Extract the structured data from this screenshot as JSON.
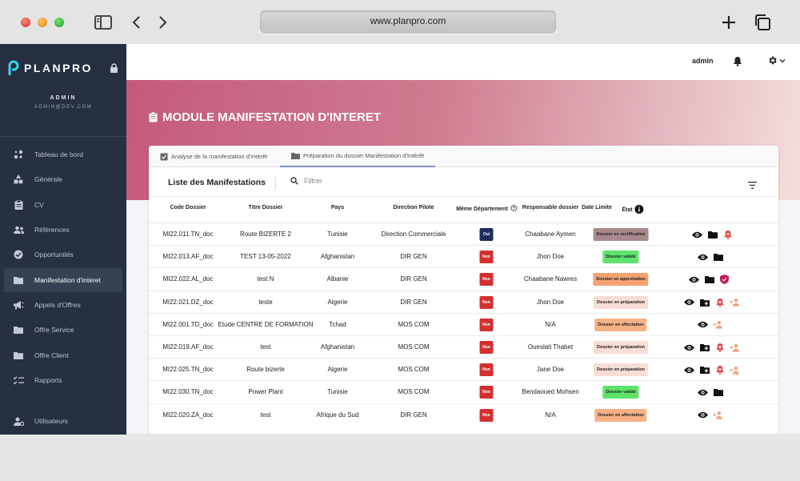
{
  "browser": {
    "url": "www.planpro.com"
  },
  "sidebar": {
    "logo_text": "PLANPRO",
    "admin_title": "ADMIN",
    "admin_email": "ADMIN@DEV.COM",
    "items": [
      {
        "label": "Tableau de bord",
        "icon": "dashboard-icon"
      },
      {
        "label": "Générale",
        "icon": "shapes-icon"
      },
      {
        "label": "CV",
        "icon": "clipboard-icon"
      },
      {
        "label": "Références",
        "icon": "users-icon"
      },
      {
        "label": "Opportunités",
        "icon": "check-circle-icon"
      },
      {
        "label": "Manifestation d'interet",
        "icon": "folder-icon"
      },
      {
        "label": "Appels d'Offres",
        "icon": "megaphone-icon"
      },
      {
        "label": "Offre Service",
        "icon": "folder-icon"
      },
      {
        "label": "Offre Client",
        "icon": "folder-icon"
      },
      {
        "label": "Rapports",
        "icon": "checklist-icon"
      },
      {
        "label": "Utilisateurs",
        "icon": "user-gear-icon"
      }
    ]
  },
  "topbar": {
    "username": "admin"
  },
  "page": {
    "title": "MODULE MANIFESTATION D'INTERET"
  },
  "tabs": [
    {
      "label": "Analyse de la manifestation d'intérêt"
    },
    {
      "label": "Préparation du dossier Manifestation d'Intérêt"
    }
  ],
  "list": {
    "title": "Liste des Manifestations",
    "filter_placeholder": "Filtrer"
  },
  "columns": [
    "Code Dossier",
    "Titre Dossier",
    "Pays",
    "Direction Pilote",
    "Même Département",
    "Responsable dossier",
    "Date Limite",
    "État"
  ],
  "colors": {
    "oui": "#1c2f5e",
    "non": "#d32f2f"
  },
  "rows": [
    {
      "code": "MI22.011.TN_doc",
      "titre": "Route BIZERTE 2",
      "pays": "Tunisie",
      "direction": "Direction Commerciale",
      "dept": "Oui",
      "responsable": "Chaabane Aymen",
      "date": "",
      "etat": "Dossier en rectification",
      "etat_color": "#a9888c",
      "actions": [
        "eye",
        "folder",
        "bell-plus"
      ]
    },
    {
      "code": "MI22.013.AF_doc",
      "titre": "TEST 13-05-2022",
      "pays": "Afghanistan",
      "direction": "DIR GEN",
      "dept": "Non",
      "responsable": "Jhon Doe",
      "date": "",
      "etat": "Dossier validé",
      "etat_color": "#5ee36a",
      "actions": [
        "eye",
        "folder"
      ]
    },
    {
      "code": "MI22.022.AL_doc",
      "titre": "test N",
      "pays": "Albanie",
      "direction": "DIR GEN",
      "dept": "Non",
      "responsable": "Chaabane Nawres",
      "date": "",
      "etat": "Dossier en approbation",
      "etat_color": "#f4a271",
      "actions": [
        "eye",
        "folder",
        "shield"
      ]
    },
    {
      "code": "MI22.021.DZ_doc",
      "titre": "teste",
      "pays": "Algerie",
      "direction": "DIR GEN",
      "dept": "Non",
      "responsable": "Jhon Doe",
      "date": "",
      "etat": "Dossier en préparation",
      "etat_color": "#f7ddd5",
      "actions": [
        "eye",
        "folder-plus",
        "bell-plus",
        "user-plus"
      ]
    },
    {
      "code": "MI22.001.TD_doc",
      "titre": "Etude CENTRE DE FORMATION",
      "pays": "Tchad",
      "direction": "MOS COM",
      "dept": "Non",
      "responsable": "N/A",
      "date": "",
      "etat": "Dossier en affectation",
      "etat_color": "#f6b185",
      "actions": [
        "eye",
        "user-plus"
      ]
    },
    {
      "code": "MI22.019.AF_doc",
      "titre": "test",
      "pays": "Afghanistan",
      "direction": "MOS COM",
      "dept": "Non",
      "responsable": "Oueslati Thabet",
      "date": "",
      "etat": "Dossier en préparation",
      "etat_color": "#f7ddd5",
      "actions": [
        "eye",
        "folder-plus",
        "bell-plus",
        "user-plus"
      ]
    },
    {
      "code": "MI22.025.TN_doc",
      "titre": "Route bizerte",
      "pays": "Algerie",
      "direction": "MOS COM",
      "dept": "Non",
      "responsable": "Jane Doe",
      "date": "",
      "etat": "Dossier en préparation",
      "etat_color": "#f7ddd5",
      "actions": [
        "eye",
        "folder-plus",
        "bell-plus",
        "user-plus"
      ]
    },
    {
      "code": "MI22.030.TN_doc",
      "titre": "Power Plant",
      "pays": "Tunisie",
      "direction": "MOS COM",
      "dept": "Non",
      "responsable": "Bendaoued Mohsen",
      "date": "",
      "etat": "Dossier validé",
      "etat_color": "#5ee36a",
      "actions": [
        "eye",
        "folder"
      ]
    },
    {
      "code": "MI22.020.ZA_doc",
      "titre": "test",
      "pays": "Afrique du Sud",
      "direction": "DIR GEN",
      "dept": "Non",
      "responsable": "N/A",
      "date": "",
      "etat": "Dossier en affectation",
      "etat_color": "#f6b185",
      "actions": [
        "eye",
        "user-plus"
      ]
    }
  ]
}
